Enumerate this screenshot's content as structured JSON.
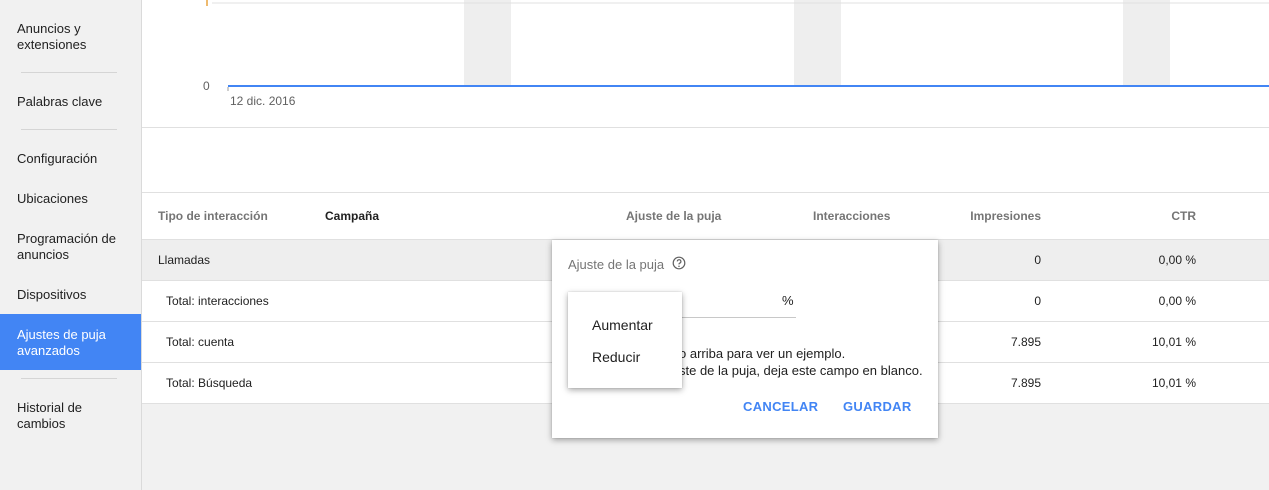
{
  "sidebar": {
    "items": [
      {
        "label": "Anuncios y extensiones",
        "lines": [
          "Anuncios y",
          "extensiones"
        ]
      },
      {
        "label": "Palabras clave"
      },
      {
        "label": "Configuración"
      },
      {
        "label": "Ubicaciones"
      },
      {
        "label": "Programación de anuncios",
        "lines": [
          "Programación de",
          "anuncios"
        ]
      },
      {
        "label": "Dispositivos"
      },
      {
        "label": "Ajustes de puja avanzados",
        "lines": [
          "Ajustes de puja",
          "avanzados"
        ],
        "active": true
      },
      {
        "label": "Historial de cambios",
        "lines": [
          "Historial de",
          "cambios"
        ]
      }
    ]
  },
  "chart": {
    "y_tick_zero": "0",
    "x_label": "12 dic. 2016",
    "line_color": "#4285f4"
  },
  "table": {
    "headers": {
      "type": "Tipo de interacción",
      "campaign": "Campaña",
      "bid_adjust": "Ajuste de la puja",
      "interactions": "Interacciones",
      "impressions": "Impresiones",
      "ctr": "CTR"
    },
    "rows": [
      {
        "type": "Llamadas",
        "impressions": "0",
        "ctr": "0,00 %"
      },
      {
        "type": "Total: interacciones",
        "impressions": "0",
        "ctr": "0,00 %"
      },
      {
        "type": "Total: cuenta",
        "impressions": "7.895",
        "ctr": "10,01 %"
      },
      {
        "type": "Total: Búsqueda",
        "impressions": "7.895",
        "ctr": "10,01 %"
      }
    ]
  },
  "dialog": {
    "title": "Ajuste de la puja",
    "percent_symbol": "%",
    "hint_line1": "o arriba para ver un ejemplo.",
    "hint_line2": "ste de la puja, deja este campo en blanco.",
    "cancel_label": "CANCELAR",
    "save_label": "GUARDAR"
  },
  "menu": {
    "options": [
      "Aumentar",
      "Reducir"
    ]
  },
  "colors": {
    "accent": "#4285f4"
  }
}
